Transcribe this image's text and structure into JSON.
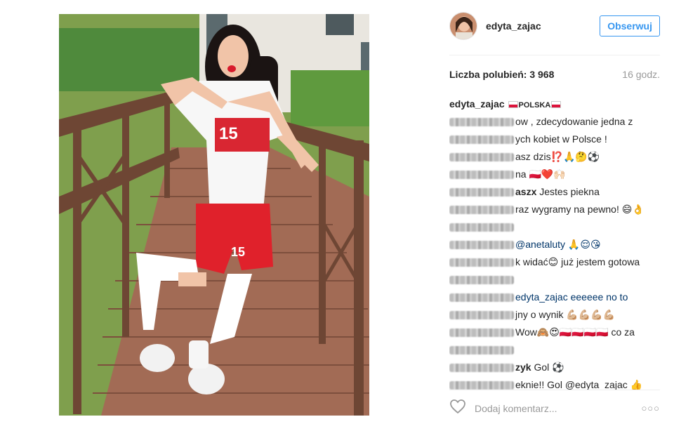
{
  "post": {
    "username": "edyta_zajac",
    "follow_label": "Obserwuj",
    "likes": "Liczba polubień: 3 968",
    "time": "16 godz.",
    "add_comment_placeholder": "Dodaj komentarz...",
    "more_label": "○○○"
  },
  "caption": {
    "username": "edyta_zajac",
    "text": "POLSKA"
  },
  "comments": [
    {
      "user_prefix": "",
      "text": "ow , zdecydowanie jedna z"
    },
    {
      "user_prefix": "",
      "text": "ych kobiet w Polsce !"
    },
    {
      "user_prefix": "",
      "text": "asz dzis⁉️🙏🤔⚽"
    },
    {
      "user_prefix": "",
      "text": "na 🇵🇱❤️🙌🏻"
    },
    {
      "user_prefix": "aszx",
      "text": " Jestes piekna"
    },
    {
      "user_prefix": "",
      "text": "raz wygramy na pewno! 😄👌"
    },
    {
      "user_prefix": "",
      "text": " "
    },
    {
      "user_prefix": "",
      "text": "@anetaluty 🙏😌😘"
    },
    {
      "user_prefix": "",
      "text": "k widać😊 już jestem gotowa"
    },
    {
      "user_prefix": "",
      "text": " "
    },
    {
      "user_prefix": "",
      "text": "edyta_zajac eeeeee no to"
    },
    {
      "user_prefix": "",
      "text": "jny o wynik 💪🏼💪🏼💪🏼💪🏼"
    },
    {
      "user_prefix": "",
      "text": "Wow🙈😍🇵🇱🇵🇱🇵🇱🇵🇱 co za"
    },
    {
      "user_prefix": "",
      "text": " "
    },
    {
      "user_prefix": "zyk",
      "text": " Gol ⚽"
    },
    {
      "user_prefix": "",
      "text": "eknie!! Gol @edyta_zajac 👍"
    },
    {
      "user_prefix": "",
      "text": "👊🇵🇱"
    }
  ],
  "colors": {
    "accent": "#3897f0",
    "text": "#262626",
    "muted": "#999999",
    "mention": "#003569"
  },
  "icons": {
    "heart": "heart-icon",
    "more": "more-icon"
  }
}
